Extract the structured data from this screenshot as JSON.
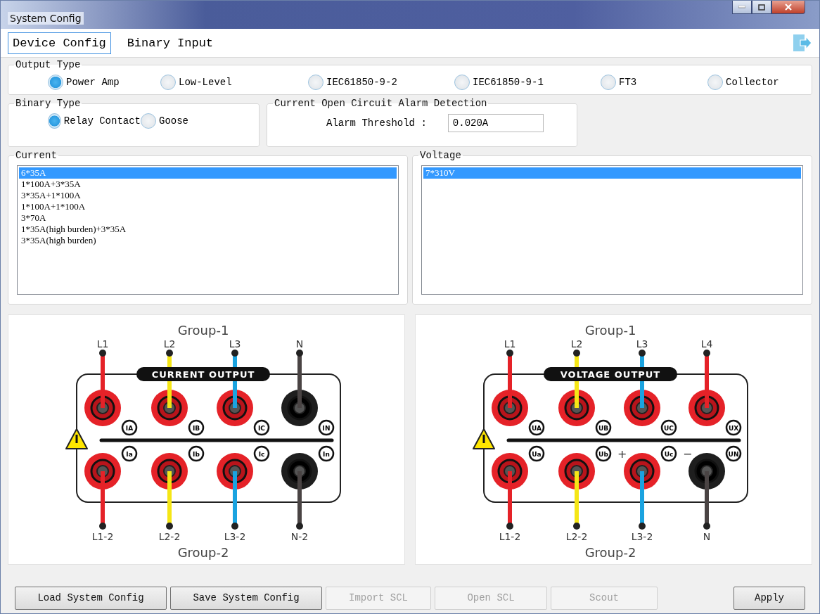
{
  "window": {
    "title": "System Config"
  },
  "tabs": [
    {
      "label": "Device Config",
      "selected": true
    },
    {
      "label": "Binary Input",
      "selected": false
    }
  ],
  "output_type": {
    "title": "Output Type",
    "options": [
      {
        "label": "Power Amp",
        "selected": true
      },
      {
        "label": "Low-Level",
        "selected": false
      },
      {
        "label": "IEC61850-9-2",
        "selected": false
      },
      {
        "label": "IEC61850-9-1",
        "selected": false
      },
      {
        "label": "FT3",
        "selected": false
      },
      {
        "label": "Collector",
        "selected": false
      }
    ]
  },
  "binary_type": {
    "title": "Binary Type",
    "options": [
      {
        "label": "Relay Contact",
        "selected": true
      },
      {
        "label": "Goose",
        "selected": false
      }
    ]
  },
  "alarm": {
    "title": "Current Open Circuit Alarm Detection",
    "label": "Alarm Threshold :",
    "value": "0.020A"
  },
  "current": {
    "title": "Current",
    "items": [
      {
        "label": "6*35A",
        "selected": true
      },
      {
        "label": "1*100A+3*35A",
        "selected": false
      },
      {
        "label": "3*35A+1*100A",
        "selected": false
      },
      {
        "label": "1*100A+1*100A",
        "selected": false
      },
      {
        "label": "3*70A",
        "selected": false
      },
      {
        "label": "1*35A(high burden)+3*35A",
        "selected": false
      },
      {
        "label": "3*35A(high burden)",
        "selected": false
      }
    ]
  },
  "voltage": {
    "title": "Voltage",
    "items": [
      {
        "label": "7*310V",
        "selected": true
      }
    ]
  },
  "diagrams": [
    {
      "group_top": "Group-1",
      "group_bottom": "Group-2",
      "label": "CURRENT OUTPUT",
      "top": [
        {
          "label": "L1",
          "color": "#e52228",
          "kind": "red",
          "badge": "IA"
        },
        {
          "label": "L2",
          "color": "#f5e616",
          "kind": "red",
          "badge": "IB"
        },
        {
          "label": "L3",
          "color": "#1aa3e0",
          "kind": "red",
          "badge": "IC"
        },
        {
          "label": "N",
          "color": "#4a4444",
          "kind": "black",
          "badge": "IN"
        }
      ],
      "bottom": [
        {
          "label": "L1-2",
          "color": "#e52228",
          "kind": "red",
          "badge": "Ia"
        },
        {
          "label": "L2-2",
          "color": "#f5e616",
          "kind": "red",
          "badge": "Ib"
        },
        {
          "label": "L3-2",
          "color": "#1aa3e0",
          "kind": "red",
          "badge": "Ic"
        },
        {
          "label": "N-2",
          "color": "#4a4444",
          "kind": "black",
          "badge": "In"
        }
      ]
    },
    {
      "group_top": "Group-1",
      "group_bottom": "Group-2",
      "label": "VOLTAGE OUTPUT",
      "top": [
        {
          "label": "L1",
          "color": "#e52228",
          "kind": "red",
          "badge": "UA"
        },
        {
          "label": "L2",
          "color": "#f5e616",
          "kind": "red",
          "badge": "UB"
        },
        {
          "label": "L3",
          "color": "#1aa3e0",
          "kind": "red",
          "badge": "UC"
        },
        {
          "label": "L4",
          "color": "#e52228",
          "kind": "red",
          "badge": "UX"
        }
      ],
      "bottom": [
        {
          "label": "L1-2",
          "color": "#e52228",
          "kind": "red",
          "badge": "Ua"
        },
        {
          "label": "L2-2",
          "color": "#f5e616",
          "kind": "red",
          "badge": "Ub",
          "sign": "+"
        },
        {
          "label": "L3-2",
          "color": "#1aa3e0",
          "kind": "red",
          "badge": "Uc",
          "sign": "−"
        },
        {
          "label": "N",
          "color": "#4a4444",
          "kind": "black",
          "badge": "UN"
        }
      ]
    }
  ],
  "buttons": [
    {
      "label": "Load System Config",
      "disabled": false
    },
    {
      "label": "Save System Config",
      "disabled": false
    },
    {
      "label": "Import SCL",
      "disabled": true
    },
    {
      "label": "Open SCL",
      "disabled": true
    },
    {
      "label": "Scout",
      "disabled": true
    },
    {
      "label": "Apply",
      "disabled": false
    }
  ]
}
